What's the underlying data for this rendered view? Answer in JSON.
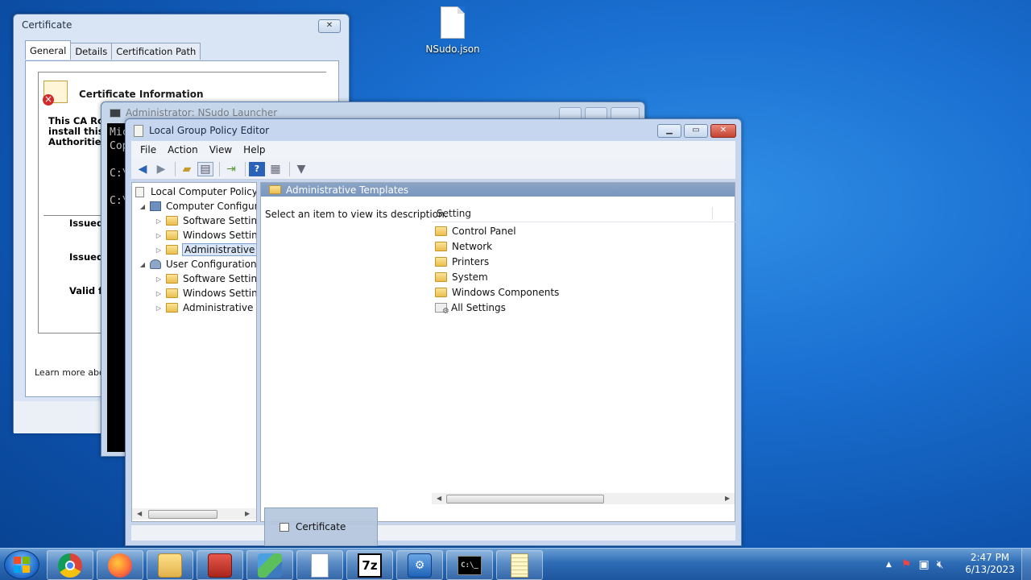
{
  "desktop": {
    "icon_label": "NSudo.json"
  },
  "cert_window": {
    "title": "Certificate",
    "close_glyph": "✕",
    "tabs": [
      "General",
      "Details",
      "Certification Path"
    ],
    "info_title": "Certificate Information",
    "message_lines": "This CA Roo\ninstall this c\nAuthorities",
    "issued_to": "Issued",
    "issued_by": "Issued",
    "valid_from": "Valid fr",
    "learn_more": "Learn more about"
  },
  "cmd_window": {
    "title": "Administrator: NSudo Launcher",
    "console_lines": "Mic\nCop\n\nC:\\\n\nC:\\"
  },
  "gpe_window": {
    "title": "Local Group Policy Editor",
    "menu": {
      "file": "File",
      "action": "Action",
      "view": "View",
      "help": "Help"
    },
    "tree": {
      "root": "Local Computer Policy",
      "computer_config": "Computer Configuration",
      "cc_software": "Software Settings",
      "cc_windows": "Windows Settings",
      "cc_admin": "Administrative Templates",
      "user_config": "User Configuration",
      "uc_software": "Software Settings",
      "uc_windows": "Windows Settings",
      "uc_admin": "Administrative Templates"
    },
    "right_header": "Administrative Templates",
    "description": "Select an item to view its description.",
    "column_setting": "Setting",
    "settings": [
      "Control Panel",
      "Network",
      "Printers",
      "System",
      "Windows Components",
      "All Settings"
    ]
  },
  "taskbar": {
    "thumbnail_label": "Certificate",
    "clock_time": "2:47 PM",
    "clock_date": "6/13/2023",
    "apps": [
      "chrome-icon",
      "firefox-icon",
      "explorer-icon",
      "toolbox-icon",
      "registry-icon",
      "blank-document-icon",
      "7zip-icon",
      "mmc-icon",
      "cmd-icon",
      "notepad-icon"
    ],
    "sevenzip_label": "7z"
  }
}
